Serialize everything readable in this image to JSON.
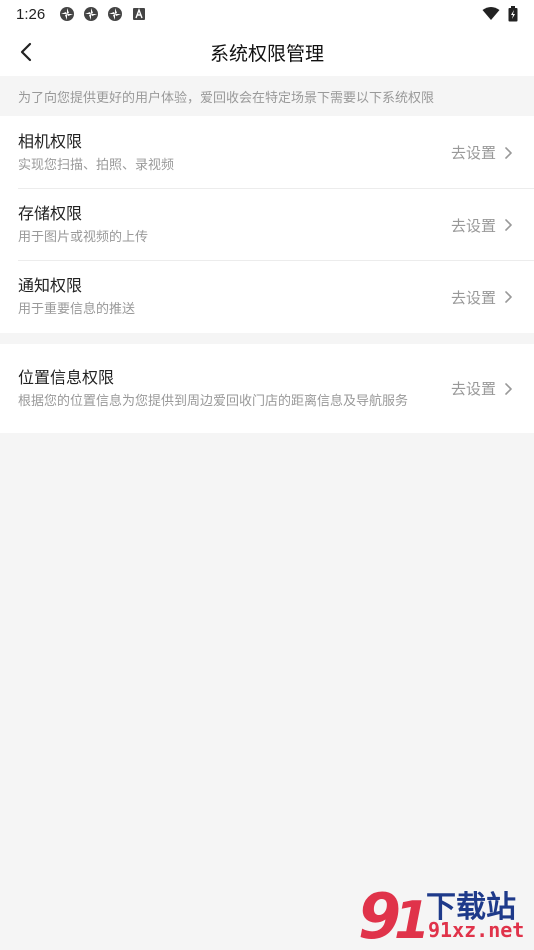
{
  "status": {
    "time": "1:26"
  },
  "header": {
    "title": "系统权限管理"
  },
  "notice": "为了向您提供更好的用户体验，爱回收会在特定场景下需要以下系统权限",
  "permissions": [
    {
      "title": "相机权限",
      "desc": "实现您扫描、拍照、录视频",
      "action": "去设置"
    },
    {
      "title": "存储权限",
      "desc": "用于图片或视频的上传",
      "action": "去设置"
    },
    {
      "title": "通知权限",
      "desc": "用于重要信息的推送",
      "action": "去设置"
    },
    {
      "title": "位置信息权限",
      "desc": "根据您的位置信息为您提供到周边爱回收门店的距离信息及导航服务",
      "action": "去设置"
    }
  ],
  "watermark": {
    "line1": "下载站",
    "line2": "91xz.net"
  }
}
